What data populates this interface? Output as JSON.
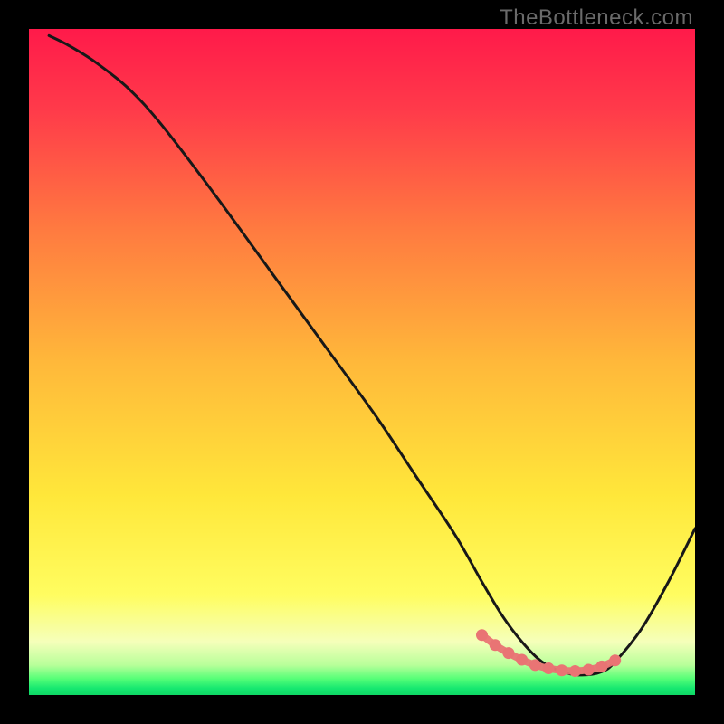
{
  "watermark": "TheBottleneck.com",
  "colors": {
    "frame": "#000000",
    "gradient_stops": [
      {
        "offset": 0.0,
        "color": "#ff1a4a"
      },
      {
        "offset": 0.12,
        "color": "#ff3a4a"
      },
      {
        "offset": 0.3,
        "color": "#ff7a40"
      },
      {
        "offset": 0.5,
        "color": "#ffb83a"
      },
      {
        "offset": 0.7,
        "color": "#ffe73a"
      },
      {
        "offset": 0.85,
        "color": "#fffd60"
      },
      {
        "offset": 0.92,
        "color": "#f5ffba"
      },
      {
        "offset": 0.955,
        "color": "#b8ff9a"
      },
      {
        "offset": 0.975,
        "color": "#58ff78"
      },
      {
        "offset": 0.99,
        "color": "#16e870"
      },
      {
        "offset": 1.0,
        "color": "#0fd865"
      }
    ],
    "curve": "#181818",
    "marker_fill": "#e97474",
    "marker_stroke": "#e97474"
  },
  "chart_data": {
    "type": "line",
    "title": "",
    "xlabel": "",
    "ylabel": "",
    "xlim": [
      0,
      100
    ],
    "ylim": [
      0,
      100
    ],
    "grid": false,
    "legend": false,
    "series": [
      {
        "name": "bottleneck-curve",
        "x": [
          3,
          6,
          10,
          15,
          20,
          28,
          36,
          44,
          52,
          58,
          64,
          68,
          71,
          74,
          77,
          80,
          83,
          86,
          88,
          92,
          96,
          100
        ],
        "y": [
          99,
          97.5,
          95,
          91,
          85.5,
          75,
          64,
          53,
          42,
          33,
          24,
          17,
          12,
          8,
          5,
          3.5,
          3,
          3.5,
          5,
          10,
          17,
          25
        ]
      }
    ],
    "markers": {
      "name": "highlight-segment",
      "x": [
        68,
        70,
        72,
        74,
        76,
        78,
        80,
        82,
        84,
        86,
        88
      ],
      "y": [
        9.0,
        7.5,
        6.3,
        5.3,
        4.5,
        4.0,
        3.7,
        3.6,
        3.8,
        4.3,
        5.2
      ]
    }
  }
}
